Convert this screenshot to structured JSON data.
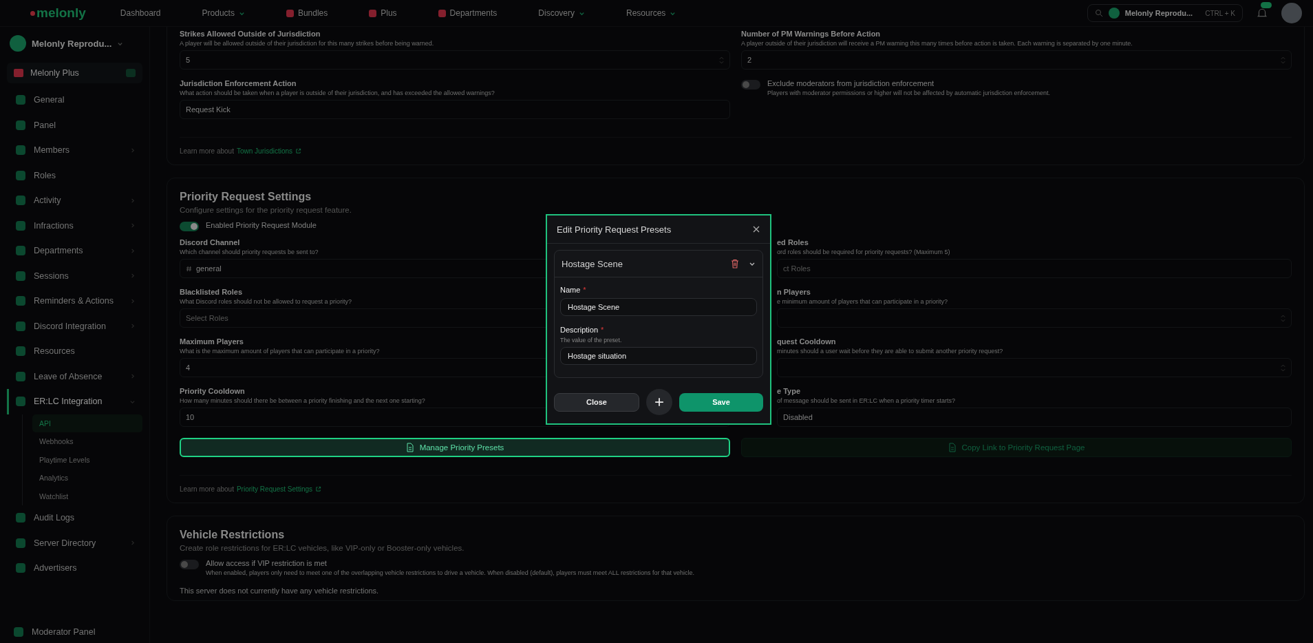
{
  "nav": {
    "logo": "melonly",
    "items": [
      {
        "label": "Dashboard",
        "has_menu": false,
        "icon": false
      },
      {
        "label": "Products",
        "has_menu": true,
        "icon": false
      },
      {
        "label": "Bundles",
        "has_menu": false,
        "icon": true
      },
      {
        "label": "Plus",
        "has_menu": false,
        "icon": true
      },
      {
        "label": "Departments",
        "has_menu": false,
        "icon": true
      },
      {
        "label": "Discovery",
        "has_menu": true,
        "icon": false
      },
      {
        "label": "Resources",
        "has_menu": true,
        "icon": false
      }
    ],
    "search": {
      "server": "Melonly Reprodu...",
      "shortcut": "CTRL + K"
    }
  },
  "sidebar": {
    "server": "Melonly Reprodu...",
    "plus": "Melonly Plus",
    "items": [
      {
        "label": "General",
        "has_submenu": false,
        "selected": false
      },
      {
        "label": "Panel",
        "has_submenu": false,
        "selected": false
      },
      {
        "label": "Members",
        "has_submenu": true,
        "selected": false
      },
      {
        "label": "Roles",
        "has_submenu": false,
        "selected": false
      },
      {
        "label": "Activity",
        "has_submenu": true,
        "selected": false
      },
      {
        "label": "Infractions",
        "has_submenu": true,
        "selected": false
      },
      {
        "label": "Departments",
        "has_submenu": true,
        "selected": false
      },
      {
        "label": "Sessions",
        "has_submenu": true,
        "selected": false
      },
      {
        "label": "Reminders & Actions",
        "has_submenu": true,
        "selected": false
      },
      {
        "label": "Discord Integration",
        "has_submenu": true,
        "selected": false
      },
      {
        "label": "Resources",
        "has_submenu": false,
        "selected": false
      },
      {
        "label": "Leave of Absence",
        "has_submenu": true,
        "selected": false
      },
      {
        "label": "ER:LC Integration",
        "has_submenu": true,
        "selected": true,
        "children": [
          {
            "label": "API",
            "selected": true
          },
          {
            "label": "Webhooks",
            "selected": false
          },
          {
            "label": "Playtime Levels",
            "selected": false
          },
          {
            "label": "Analytics",
            "selected": false
          },
          {
            "label": "Watchlist",
            "selected": false
          }
        ]
      },
      {
        "label": "Audit Logs",
        "has_submenu": false,
        "selected": false
      },
      {
        "label": "Server Directory",
        "has_submenu": true,
        "selected": false
      },
      {
        "label": "Advertisers",
        "has_submenu": false,
        "selected": false
      }
    ],
    "footer": "Moderator Panel"
  },
  "sections": [
    {
      "columns": [
        [
          {
            "kind": "number",
            "label": "Strikes Allowed Outside of Jurisdiction",
            "description": "A player will be allowed outside of their jurisdiction for this many strikes before being warned.",
            "value": "5"
          },
          {
            "kind": "select",
            "label": "Jurisdiction Enforcement Action",
            "description": "What action should be taken when a player is outside of their jurisdiction, and has exceeded the allowed warnings?",
            "value": "Request Kick"
          }
        ],
        [
          {
            "kind": "number",
            "label": "Number of PM Warnings Before Action",
            "description": "A player outside of their jurisdiction will receive a PM warning this many times before action is taken. Each warning is separated by one minute.",
            "value": "2"
          },
          {
            "kind": "toggle",
            "label": "Exclude moderators from jurisdiction enforcement",
            "description": "Players with moderator permissions or higher will not be affected by automatic jurisdiction enforcement.",
            "on": false
          }
        ]
      ],
      "footer": {
        "text": "Learn more about",
        "link": "Town Jurisdictions"
      }
    },
    {
      "title": "Priority Request Settings",
      "subtitle": "Configure settings for the priority request feature.",
      "toggle": {
        "label": "Enabled Priority Request Module",
        "on": true
      },
      "columns": [
        [
          {
            "kind": "channel",
            "label": "Discord Channel",
            "description": "Which channel should priority requests be sent to?",
            "value": "general"
          },
          {
            "kind": "roles",
            "label": "Blacklisted Roles",
            "description": "What Discord roles should not be allowed to request a priority?",
            "placeholder": "Select Roles"
          },
          {
            "kind": "number",
            "label": "Maximum Players",
            "description": "What is the maximum amount of players that can participate in a priority?",
            "value": "4"
          },
          {
            "kind": "number",
            "label": "Priority Cooldown",
            "description": "How many minutes should there be between a priority finishing and the next one starting?",
            "value": "10"
          }
        ],
        [
          {
            "kind": "roles",
            "label": "ed Roles",
            "description": "ord roles should be required for priority requests? (Maximum 5)",
            "placeholder": "ct Roles"
          },
          {
            "kind": "number",
            "label": "n Players",
            "description": "e minimum amount of players that can participate in a priority?"
          },
          {
            "kind": "number",
            "label": "quest Cooldown",
            "description": "minutes should a user wait before they are able to submit another priority request?"
          },
          {
            "kind": "select",
            "label": "e Type",
            "description": "of message should be sent in ER:LC when a priority timer starts?",
            "value": "Disabled"
          }
        ]
      ],
      "actions": [
        {
          "label": "Manage Priority Presets",
          "highlighted": true
        },
        {
          "label": "Copy Link to Priority Request Page",
          "highlighted": false
        }
      ],
      "footer": {
        "text": "Learn more about",
        "link": "Priority Request Settings"
      }
    },
    {
      "title": "Vehicle Restrictions",
      "subtitle": "Create role restrictions for ER:LC vehicles, like VIP-only or Booster-only vehicles.",
      "toggle": {
        "label": "Allow access if VIP restriction is met",
        "description": "When enabled, players only need to meet one of the overlapping vehicle restrictions to drive a vehicle. When disabled (default), players must meet ALL restrictions for that vehicle.",
        "on": false
      },
      "note": "This server does not currently have any vehicle restrictions."
    }
  ],
  "modal": {
    "title": "Edit Priority Request Presets",
    "presets": [
      {
        "name": "Hostage Scene",
        "expanded": true,
        "fields": [
          {
            "label": "Name",
            "required_mark": "*",
            "value": "Hostage Scene"
          },
          {
            "label": "Description",
            "required_mark": "*",
            "hint": "The value of the preset.",
            "value": "Hostage situation"
          }
        ]
      }
    ],
    "buttons": {
      "close": "Close",
      "save": "Save"
    }
  }
}
